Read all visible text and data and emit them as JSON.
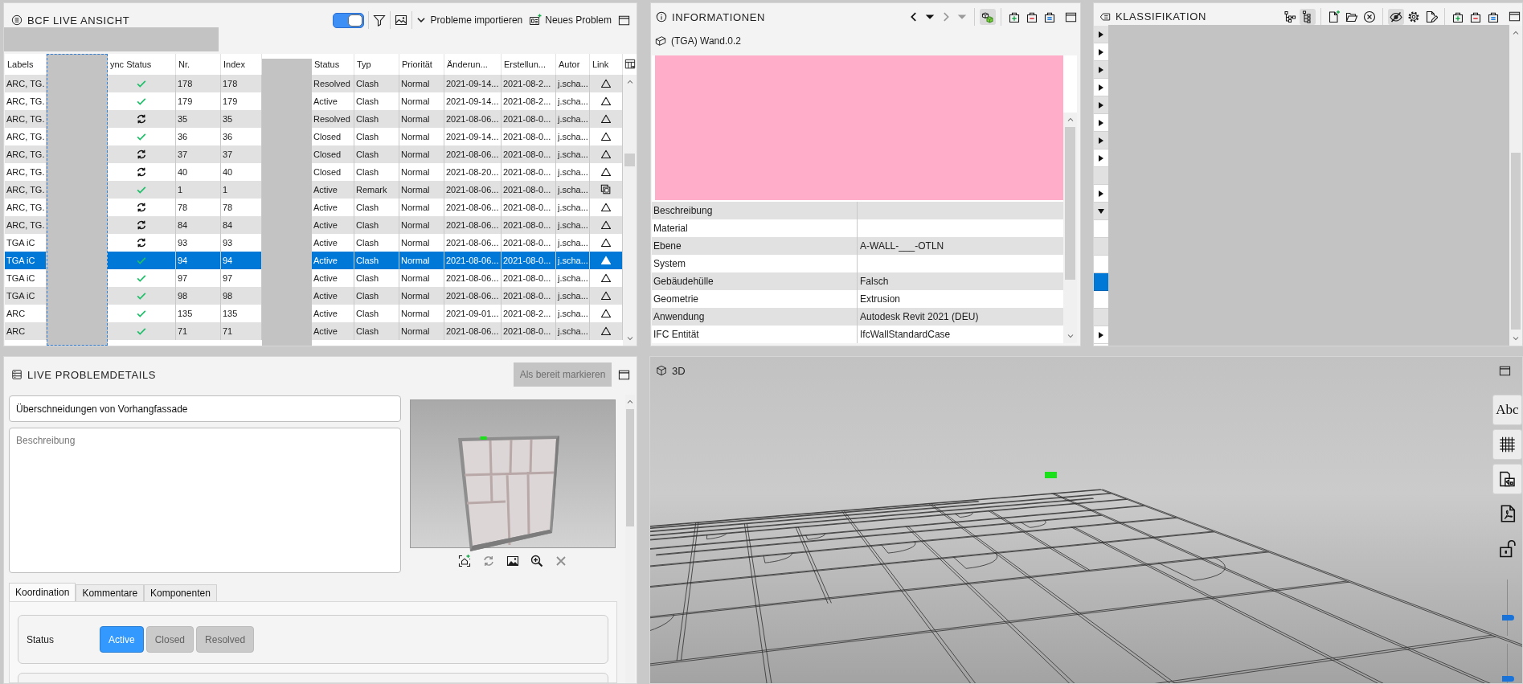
{
  "bcf_view": {
    "title": "BCF LIVE ANSICHT",
    "live_toggle": {
      "on": true
    },
    "import_button": "Probleme importieren",
    "new_button": "Neues Problem",
    "table": {
      "columns": [
        "Labels",
        "ync Status",
        "Nr.",
        "Index",
        "Status",
        "Typ",
        "Priorität",
        "Änderun...",
        "Erstellun...",
        "Autor",
        "Link"
      ],
      "rows": [
        {
          "labels": "ARC, TG.",
          "sync": {
            "kind": "synced"
          },
          "nr": "178",
          "index": "178",
          "status": "Resolved",
          "type": "Clash",
          "priority": "Normal",
          "modified": "2021-09-14...",
          "created": "2021-08-2...",
          "author": "j.scha...",
          "link": {
            "kind": "viewpoint"
          },
          "selected": false
        },
        {
          "labels": "ARC, TG.",
          "sync": {
            "kind": "synced"
          },
          "nr": "179",
          "index": "179",
          "status": "Active",
          "type": "Clash",
          "priority": "Normal",
          "modified": "2021-09-14...",
          "created": "2021-08-2...",
          "author": "j.scha...",
          "link": {
            "kind": "viewpoint"
          },
          "selected": false
        },
        {
          "labels": "ARC, TG.",
          "sync": {
            "kind": "pending"
          },
          "nr": "35",
          "index": "35",
          "status": "Resolved",
          "type": "Clash",
          "priority": "Normal",
          "modified": "2021-08-06...",
          "created": "2021-08-0...",
          "author": "j.scha...",
          "link": {
            "kind": "viewpoint"
          },
          "selected": false
        },
        {
          "labels": "ARC, TG.",
          "sync": {
            "kind": "synced"
          },
          "nr": "36",
          "index": "36",
          "status": "Closed",
          "type": "Clash",
          "priority": "Normal",
          "modified": "2021-09-14...",
          "created": "2021-08-0...",
          "author": "j.scha...",
          "link": {
            "kind": "viewpoint"
          },
          "selected": false
        },
        {
          "labels": "ARC, TG.",
          "sync": {
            "kind": "pending"
          },
          "nr": "37",
          "index": "37",
          "status": "Closed",
          "type": "Clash",
          "priority": "Normal",
          "modified": "2021-08-06...",
          "created": "2021-08-0...",
          "author": "j.scha...",
          "link": {
            "kind": "viewpoint"
          },
          "selected": false
        },
        {
          "labels": "ARC, TG.",
          "sync": {
            "kind": "pending"
          },
          "nr": "40",
          "index": "40",
          "status": "Closed",
          "type": "Clash",
          "priority": "Normal",
          "modified": "2021-08-20...",
          "created": "2021-08-0...",
          "author": "j.scha...",
          "link": {
            "kind": "viewpoint"
          },
          "selected": false
        },
        {
          "labels": "ARC, TG.",
          "sync": {
            "kind": "synced"
          },
          "nr": "1",
          "index": "1",
          "status": "Active",
          "type": "Remark",
          "priority": "Normal",
          "modified": "2021-08-06...",
          "created": "2021-08-0...",
          "author": "j.scha...",
          "link": {
            "kind": "snapshot"
          },
          "selected": false
        },
        {
          "labels": "ARC, TG.",
          "sync": {
            "kind": "pending"
          },
          "nr": "78",
          "index": "78",
          "status": "Active",
          "type": "Clash",
          "priority": "Normal",
          "modified": "2021-08-06...",
          "created": "2021-08-0...",
          "author": "j.scha...",
          "link": {
            "kind": "viewpoint"
          },
          "selected": false
        },
        {
          "labels": "ARC, TG.",
          "sync": {
            "kind": "pending"
          },
          "nr": "84",
          "index": "84",
          "status": "Active",
          "type": "Clash",
          "priority": "Normal",
          "modified": "2021-08-06...",
          "created": "2021-08-0...",
          "author": "j.scha...",
          "link": {
            "kind": "viewpoint"
          },
          "selected": false
        },
        {
          "labels": "TGA iC",
          "sync": {
            "kind": "pending"
          },
          "nr": "93",
          "index": "93",
          "status": "Active",
          "type": "Clash",
          "priority": "Normal",
          "modified": "2021-08-06...",
          "created": "2021-08-0...",
          "author": "j.scha...",
          "link": {
            "kind": "viewpoint"
          },
          "selected": false
        },
        {
          "labels": "TGA iC",
          "sync": {
            "kind": "synced"
          },
          "nr": "94",
          "index": "94",
          "status": "Active",
          "type": "Clash",
          "priority": "Normal",
          "modified": "2021-08-06...",
          "created": "2021-08-0...",
          "author": "j.scha...",
          "link": {
            "kind": "viewpoint"
          },
          "selected": true
        },
        {
          "labels": "TGA iC",
          "sync": {
            "kind": "synced"
          },
          "nr": "97",
          "index": "97",
          "status": "Active",
          "type": "Clash",
          "priority": "Normal",
          "modified": "2021-08-06...",
          "created": "2021-08-0...",
          "author": "j.scha...",
          "link": {
            "kind": "viewpoint"
          },
          "selected": false
        },
        {
          "labels": "TGA iC",
          "sync": {
            "kind": "synced"
          },
          "nr": "98",
          "index": "98",
          "status": "Active",
          "type": "Clash",
          "priority": "Normal",
          "modified": "2021-08-06...",
          "created": "2021-08-0...",
          "author": "j.scha...",
          "link": {
            "kind": "viewpoint"
          },
          "selected": false
        },
        {
          "labels": "ARC",
          "sync": {
            "kind": "synced"
          },
          "nr": "135",
          "index": "135",
          "status": "Active",
          "type": "Clash",
          "priority": "Normal",
          "modified": "2021-09-01...",
          "created": "2021-08-2...",
          "author": "j.scha...",
          "link": {
            "kind": "viewpoint"
          },
          "selected": false
        },
        {
          "labels": "ARC",
          "sync": {
            "kind": "synced"
          },
          "nr": "71",
          "index": "71",
          "status": "Active",
          "type": "Clash",
          "priority": "Normal",
          "modified": "2021-08-06...",
          "created": "2021-08-0...",
          "author": "j.scha...",
          "link": {
            "kind": "viewpoint"
          },
          "selected": false
        }
      ]
    }
  },
  "informationen": {
    "title": "INFORMATIONEN",
    "nav": [
      {
        "kind": "back",
        "disabled": false
      },
      {
        "kind": "history",
        "disabled": false
      },
      {
        "kind": "forward",
        "disabled": true
      },
      {
        "kind": "history",
        "disabled": true
      }
    ],
    "tools": [
      [
        {
          "kind": "cubes",
          "pressed": true
        }
      ],
      [
        {
          "kind": "add",
          "pressed": false
        },
        {
          "kind": "remove",
          "pressed": false
        },
        {
          "kind": "equal",
          "pressed": false
        }
      ]
    ],
    "element": "(TGA) Wand.0.2",
    "properties": [
      {
        "name": "Beschreibung"
      },
      {
        "name": "Material"
      },
      {
        "name": "Ebene",
        "value": "A-WALL-___-OTLN"
      },
      {
        "name": "System"
      },
      {
        "name": "Gebäudehülle",
        "value": "Falsch"
      },
      {
        "name": "Geometrie",
        "value": "Extrusion"
      },
      {
        "name": "Anwendung",
        "value": "Autodesk Revit 2021 (DEU)"
      },
      {
        "name": "IFC Entität",
        "value": "IfcWallStandardCase"
      }
    ]
  },
  "klassifikation": {
    "title": "KLASSIFIKATION",
    "tools": [
      [
        {
          "kind": "tree",
          "pressed": false
        },
        {
          "kind": "tree_list",
          "pressed": true
        }
      ],
      [
        {
          "kind": "new_file",
          "pressed": false
        },
        {
          "kind": "open_folder",
          "pressed": false
        },
        {
          "kind": "clear",
          "pressed": false
        }
      ],
      [
        {
          "kind": "hide",
          "pressed": true
        },
        {
          "kind": "settings",
          "pressed": false
        },
        {
          "kind": "edit",
          "pressed": false
        }
      ],
      [
        {
          "kind": "add",
          "pressed": false
        },
        {
          "kind": "remove",
          "pressed": false
        },
        {
          "kind": "equal",
          "pressed": false
        }
      ]
    ],
    "rows": [
      {
        "kind": "branch",
        "expanded": false,
        "selected": false
      },
      {
        "kind": "branch",
        "expanded": false,
        "selected": false
      },
      {
        "kind": "branch",
        "expanded": false,
        "selected": false
      },
      {
        "kind": "branch",
        "expanded": false,
        "selected": false
      },
      {
        "kind": "branch",
        "expanded": false,
        "selected": false
      },
      {
        "kind": "branch",
        "expanded": false,
        "selected": false
      },
      {
        "kind": "branch",
        "expanded": false,
        "selected": false
      },
      {
        "kind": "branch",
        "expanded": false,
        "selected": false
      },
      {
        "kind": "leaf",
        "selected": false
      },
      {
        "kind": "branch",
        "expanded": false,
        "selected": false
      },
      {
        "kind": "branch",
        "expanded": true,
        "selected": false
      },
      {
        "kind": "leaf",
        "selected": false
      },
      {
        "kind": "leaf",
        "selected": false
      },
      {
        "kind": "leaf",
        "selected": false
      },
      {
        "kind": "leaf",
        "selected": true
      },
      {
        "kind": "leaf",
        "selected": false
      },
      {
        "kind": "leaf",
        "selected": false
      },
      {
        "kind": "branch",
        "expanded": false,
        "selected": false
      }
    ]
  },
  "problem_details": {
    "title": "LIVE PROBLEMDETAILS",
    "ready_button": {
      "label": "Als bereit markieren",
      "disabled": true
    },
    "title_field": {
      "value": "Überschneidungen von Vorhangfassade"
    },
    "description_field": {
      "placeholder": "Beschreibung"
    },
    "snapshot_tools": [
      {
        "kind": "capture",
        "disabled": false
      },
      {
        "kind": "refresh",
        "disabled": true
      },
      {
        "kind": "image",
        "disabled": false
      },
      {
        "kind": "zoom",
        "disabled": false
      },
      {
        "kind": "delete",
        "disabled": true
      }
    ],
    "tabs": [
      {
        "label": "Koordination",
        "selected": true
      },
      {
        "label": "Kommentare",
        "selected": false
      },
      {
        "label": "Komponenten",
        "selected": false
      }
    ],
    "status": {
      "label": "Status",
      "options": [
        {
          "label": "Active",
          "selected": true
        },
        {
          "label": "Closed",
          "selected": false
        },
        {
          "label": "Resolved",
          "selected": false
        }
      ]
    }
  },
  "view_3d": {
    "title": "3D",
    "tools": [
      {
        "kind": "text",
        "label": "Abc",
        "pressed": true
      },
      {
        "kind": "grid",
        "pressed": true
      },
      {
        "kind": "layout",
        "pressed": true
      },
      {
        "kind": "pdf",
        "pressed": false
      },
      {
        "kind": "lock",
        "pressed": false
      }
    ],
    "sliders": [
      {
        "level": 0.3
      },
      {
        "level": 0.1
      }
    ]
  }
}
